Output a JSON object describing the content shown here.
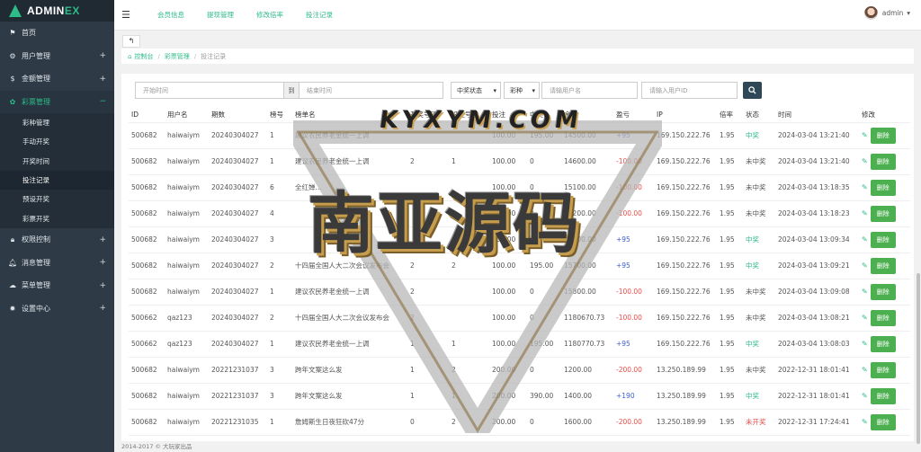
{
  "brand": {
    "prefix": "ADMIN",
    "suffix": "EX"
  },
  "sidebar": {
    "items": [
      {
        "icon": "flag-icon",
        "label": "首页"
      },
      {
        "icon": "gear-icon",
        "label": "用户管理"
      },
      {
        "icon": "dollar-icon",
        "label": "金额管理"
      },
      {
        "icon": "lottery-icon",
        "label": "彩票管理",
        "active": true
      },
      {
        "icon": "lock-icon",
        "label": "权限控制"
      },
      {
        "icon": "bell-icon",
        "label": "消息管理"
      },
      {
        "icon": "layers-icon",
        "label": "菜单管理"
      },
      {
        "icon": "cog-icon",
        "label": "设置中心"
      }
    ],
    "subitems": [
      "彩种管理",
      "手动开奖",
      "开奖时间",
      "投注记录",
      "预设开奖",
      "彩票开奖"
    ],
    "current_sub": 3
  },
  "topbar": {
    "links": [
      "会员信息",
      "提现管理",
      "修改倍率",
      "投注记录"
    ],
    "username": "admin",
    "caret": "▾"
  },
  "breadcrumb": {
    "home": "控制台",
    "section": "彩票管理",
    "current": "投注记录"
  },
  "filters": {
    "start_placeholder": "开始时间",
    "to_label": "到",
    "end_placeholder": "结束时间",
    "status_select": "中奖状态",
    "lottery_select": "彩种",
    "username_placeholder": "请输用户名",
    "userid_placeholder": "请输入用户ID"
  },
  "table": {
    "headers": [
      "ID",
      "用户名",
      "期数",
      "榜号",
      "榜单名",
      "开奖号码",
      "投注号码",
      "投注",
      "中奖",
      "余额",
      "盈亏",
      "IP",
      "倍率",
      "状态",
      "时间",
      "修改"
    ],
    "rows": [
      {
        "id": "500682",
        "user": "haiwaiym",
        "period": "20240304027",
        "rank": "1",
        "name": "建议农民养老金统一上调",
        "draw": "",
        "bet_no": "",
        "bet": "100.00",
        "win": "195.00",
        "balance": "14500.00",
        "pl": "+95",
        "pl_type": "pos",
        "ip": "169.150.222.76",
        "rate": "1.95",
        "status": "中奖",
        "status_type": "won",
        "time": "2024-03-04 13:21:40"
      },
      {
        "id": "500682",
        "user": "haiwaiym",
        "period": "20240304027",
        "rank": "1",
        "name": "建议农民养老金统一上调",
        "draw": "2",
        "bet_no": "1",
        "bet": "100.00",
        "win": "0",
        "balance": "14600.00",
        "pl": "-100.00",
        "pl_type": "neg",
        "ip": "169.150.222.76",
        "rate": "1.95",
        "status": "未中奖",
        "status_type": "lost",
        "time": "2024-03-04 13:21:40"
      },
      {
        "id": "500682",
        "user": "haiwaiym",
        "period": "20240304027",
        "rank": "6",
        "name": "全红婵…",
        "draw": "",
        "bet_no": "",
        "bet": "100.00",
        "win": "0",
        "balance": "15100.00",
        "pl": "-100.00",
        "pl_type": "neg",
        "ip": "169.150.222.76",
        "rate": "1.95",
        "status": "未中奖",
        "status_type": "lost",
        "time": "2024-03-04 13:18:35"
      },
      {
        "id": "500682",
        "user": "haiwaiym",
        "period": "20240304027",
        "rank": "4",
        "name": "",
        "draw": "",
        "bet_no": "",
        "bet": "100.00",
        "win": "0",
        "balance": "15200.00",
        "pl": "-100.00",
        "pl_type": "neg",
        "ip": "169.150.222.76",
        "rate": "1.95",
        "status": "未中奖",
        "status_type": "lost",
        "time": "2024-03-04 13:18:23"
      },
      {
        "id": "500682",
        "user": "haiwaiym",
        "period": "20240304027",
        "rank": "3",
        "name": "",
        "draw": "",
        "bet_no": "",
        "bet": "100.00",
        "win": "195.00",
        "balance": "15600.00",
        "pl": "+95",
        "pl_type": "pos",
        "ip": "169.150.222.76",
        "rate": "1.95",
        "status": "中奖",
        "status_type": "won",
        "time": "2024-03-04 13:09:34"
      },
      {
        "id": "500682",
        "user": "haiwaiym",
        "period": "20240304027",
        "rank": "2",
        "name": "十四届全国人大二次会议发布会",
        "draw": "2",
        "bet_no": "2",
        "bet": "100.00",
        "win": "195.00",
        "balance": "15700.00",
        "pl": "+95",
        "pl_type": "pos",
        "ip": "169.150.222.76",
        "rate": "1.95",
        "status": "中奖",
        "status_type": "won",
        "time": "2024-03-04 13:09:21"
      },
      {
        "id": "500682",
        "user": "haiwaiym",
        "period": "20240304027",
        "rank": "1",
        "name": "建议农民养老金统一上调",
        "draw": "2",
        "bet_no": "",
        "bet": "100.00",
        "win": "0",
        "balance": "15800.00",
        "pl": "-100.00",
        "pl_type": "neg",
        "ip": "169.150.222.76",
        "rate": "1.95",
        "status": "未中奖",
        "status_type": "lost",
        "time": "2024-03-04 13:09:08"
      },
      {
        "id": "500662",
        "user": "qaz123",
        "period": "20240304027",
        "rank": "2",
        "name": "十四届全国人大二次会议发布会",
        "draw": "2",
        "bet_no": "",
        "bet": "100.00",
        "win": "0",
        "balance": "1180670.73",
        "pl": "-100.00",
        "pl_type": "neg",
        "ip": "169.150.222.76",
        "rate": "1.95",
        "status": "未中奖",
        "status_type": "lost",
        "time": "2024-03-04 13:08:21"
      },
      {
        "id": "500662",
        "user": "qaz123",
        "period": "20240304027",
        "rank": "1",
        "name": "建议农民养老金统一上调",
        "draw": "1",
        "bet_no": "1",
        "bet": "100.00",
        "win": "195.00",
        "balance": "1180770.73",
        "pl": "+95",
        "pl_type": "pos",
        "ip": "169.150.222.76",
        "rate": "1.95",
        "status": "中奖",
        "status_type": "won",
        "time": "2024-03-04 13:08:03"
      },
      {
        "id": "500682",
        "user": "haiwaiym",
        "period": "20221231037",
        "rank": "3",
        "name": "跨年文案这么发",
        "draw": "1",
        "bet_no": "2",
        "bet": "200.00",
        "win": "0",
        "balance": "1200.00",
        "pl": "-200.00",
        "pl_type": "neg",
        "ip": "13.250.189.99",
        "rate": "1.95",
        "status": "未中奖",
        "status_type": "lost",
        "time": "2022-12-31 18:01:41"
      },
      {
        "id": "500682",
        "user": "haiwaiym",
        "period": "20221231037",
        "rank": "3",
        "name": "跨年文案这么发",
        "draw": "1",
        "bet_no": "1",
        "bet": "200.00",
        "win": "390.00",
        "balance": "1400.00",
        "pl": "+190",
        "pl_type": "pos",
        "ip": "13.250.189.99",
        "rate": "1.95",
        "status": "中奖",
        "status_type": "won",
        "time": "2022-12-31 18:01:41"
      },
      {
        "id": "500682",
        "user": "haiwaiym",
        "period": "20221231035",
        "rank": "1",
        "name": "詹姆斯生日夜狂砍47分",
        "draw": "0",
        "bet_no": "2",
        "bet": "200.00",
        "win": "0",
        "balance": "1600.00",
        "pl": "-200.00",
        "pl_type": "neg",
        "ip": "13.250.189.99",
        "rate": "1.95",
        "status": "未开奖",
        "status_type": "pending",
        "time": "2022-12-31 17:24:41"
      }
    ],
    "delete_label": "删除"
  },
  "footer": "2014-2017 © 大玩家出品",
  "watermark": {
    "url": "KYXYM.COM",
    "text": "南亚源码"
  },
  "colors": {
    "accent": "#2dbb87",
    "positive": "#3c5ccf",
    "negative": "#e54b4b",
    "delete": "#4caf50",
    "sidebar": "#2e3a46"
  }
}
